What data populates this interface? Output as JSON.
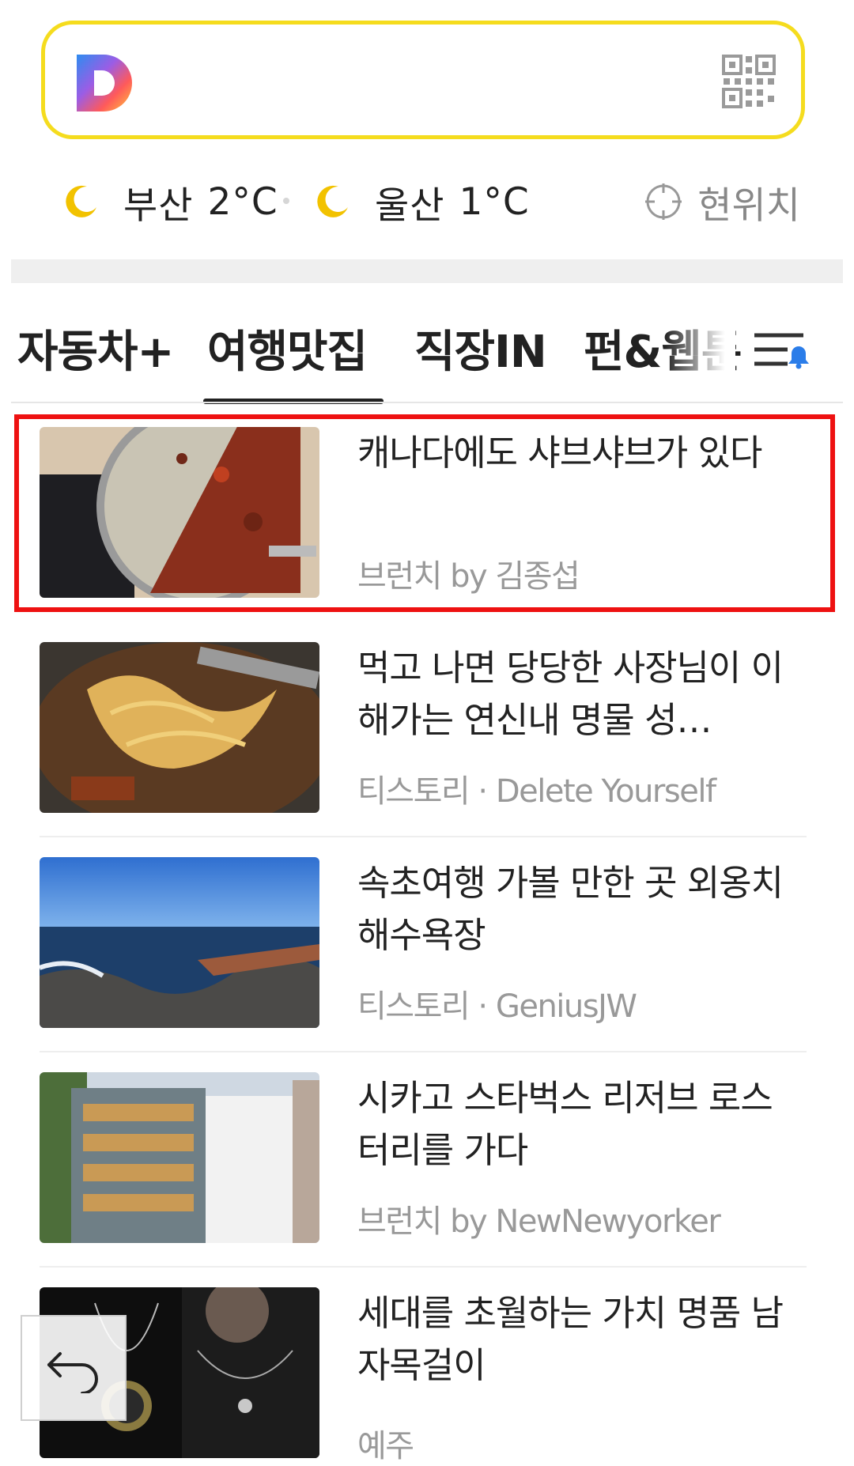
{
  "weather": [
    {
      "city": "부산",
      "temp": "2°C",
      "icon": "moon-icon"
    },
    {
      "city": "울산",
      "temp": "1°C",
      "icon": "moon-icon"
    }
  ],
  "location_label": "현위치",
  "tabs": [
    {
      "label": "자동차+"
    },
    {
      "label": "여행맛집",
      "active": true
    },
    {
      "label": "직장IN"
    },
    {
      "label": "펀&웹툰"
    }
  ],
  "articles": [
    {
      "title": "캐나다에도 샤브샤브가 있다",
      "source": "브런치 by 김종섭"
    },
    {
      "title": "먹고 나면 당당한 사장님이 이해가는 연신내 명물 성…",
      "source": "티스토리 · Delete Yourself"
    },
    {
      "title": "속초여행 가볼 만한 곳 외옹치 해수욕장",
      "source": "티스토리 · GeniusJW"
    },
    {
      "title": "시카고 스타벅스 리저브 로스터리를 가다",
      "source": "브런치 by NewNewyorker"
    },
    {
      "title": "세대를 초월하는 가치 명품 남자목걸이",
      "source": "예주"
    }
  ],
  "colors": {
    "search_border": "#f5dc1e",
    "highlight": "#ee1111",
    "notification_dot": "#2b7de9",
    "moon": "#f2c200"
  }
}
